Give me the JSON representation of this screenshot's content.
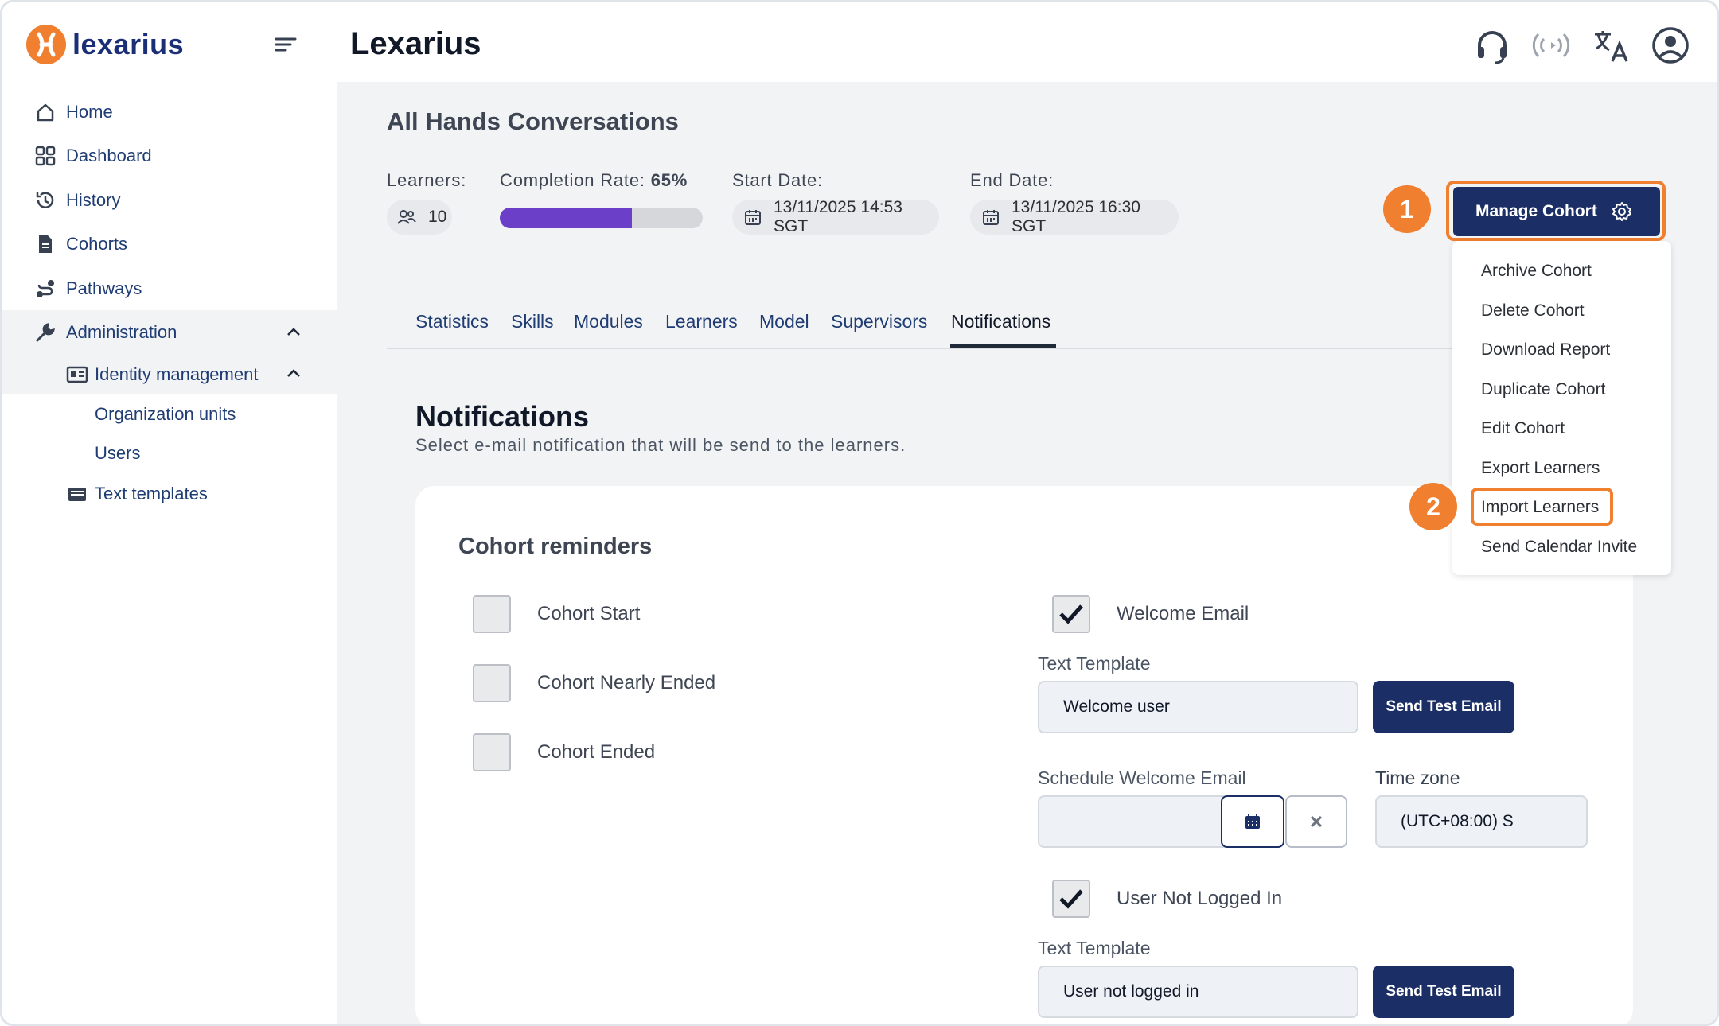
{
  "brand": {
    "name": "lexarius"
  },
  "header": {
    "title": "Lexarius",
    "icons": [
      "headset-icon",
      "broadcast-icon",
      "translate-icon",
      "user-account-icon"
    ]
  },
  "sidebar": {
    "items": [
      {
        "label": "Home",
        "icon": "home-icon"
      },
      {
        "label": "Dashboard",
        "icon": "dashboard-grid-icon"
      },
      {
        "label": "History",
        "icon": "history-icon"
      },
      {
        "label": "Cohorts",
        "icon": "document-icon"
      },
      {
        "label": "Pathways",
        "icon": "pathway-icon"
      },
      {
        "label": "Administration",
        "icon": "wrench-icon",
        "expanded": true
      }
    ],
    "sub": {
      "identity": "Identity management",
      "org_units": "Organization units",
      "users": "Users",
      "text_templates": "Text templates"
    }
  },
  "page": {
    "title": "All Hands Conversations",
    "learners_label": "Learners:",
    "learners_count": "10",
    "completion_label": "Completion Rate:",
    "completion_value": "65%",
    "completion_fraction": 0.65,
    "start_label": "Start Date:",
    "start_value": "13/11/2025 14:53 SGT",
    "end_label": "End Date:",
    "end_value": "13/11/2025 16:30 SGT"
  },
  "tabs": [
    "Statistics",
    "Skills",
    "Modules",
    "Learners",
    "Model",
    "Supervisors",
    "Notifications"
  ],
  "active_tab": "Notifications",
  "manage": {
    "button_label": "Manage Cohort",
    "menu": [
      "Archive Cohort",
      "Delete Cohort",
      "Download Report",
      "Duplicate Cohort",
      "Edit Cohort",
      "Export Learners",
      "Import Learners",
      "Send Calendar Invite"
    ],
    "badge1": "1",
    "badge2": "2",
    "highlight_color": "#f07f2f"
  },
  "notifications": {
    "title": "Notifications",
    "subtitle": "Select e-mail notification that will be send to the learners.",
    "card_title": "Cohort reminders",
    "left_checks": [
      {
        "label": "Cohort Start",
        "checked": false
      },
      {
        "label": "Cohort Nearly Ended",
        "checked": false
      },
      {
        "label": "Cohort Ended",
        "checked": false
      }
    ],
    "welcome": {
      "label": "Welcome Email",
      "checked": true,
      "template_label": "Text Template",
      "template_value": "Welcome user",
      "send_label": "Send Test Email"
    },
    "schedule": {
      "label": "Schedule Welcome Email",
      "value": "",
      "tz_label": "Time zone",
      "tz_value": "(UTC+08:00) S"
    },
    "not_logged": {
      "label": "User Not Logged In",
      "checked": true,
      "template_label": "Text Template",
      "template_value": "User not logged in",
      "send_label": "Send Test Email"
    }
  },
  "colors": {
    "accent": "#f07f2f",
    "navy": "#1b2e66",
    "progress": "#6b3fc8"
  }
}
